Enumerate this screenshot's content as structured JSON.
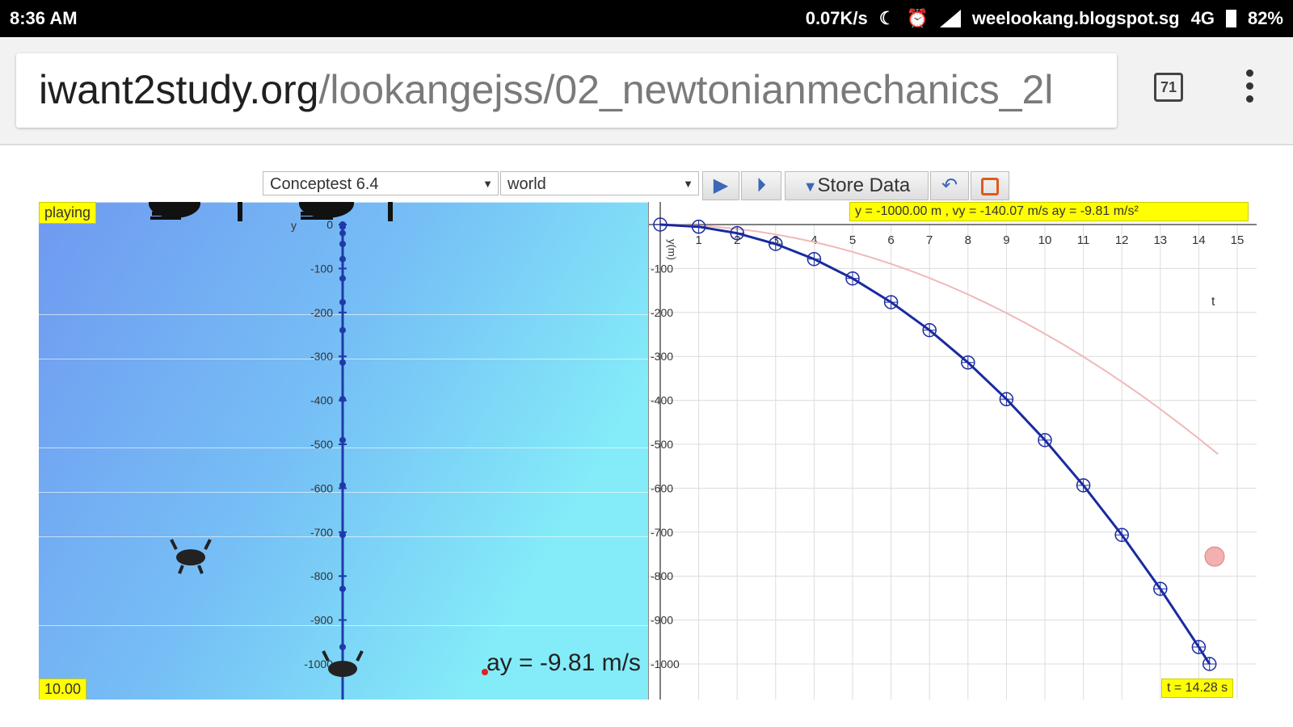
{
  "status_bar": {
    "time": "8:36 AM",
    "speed": "0.07K/s",
    "site": "weelookang.blogspot.sg",
    "network": "4G",
    "battery": "82%"
  },
  "browser": {
    "url_host": "iwant2study.org",
    "url_path": "/lookangejss/02_newtonianmechanics_2l",
    "tab_count": "71"
  },
  "controls": {
    "concept_select": "Conceptest 6.4",
    "frame_select": "world",
    "store_data_label": "Store Data"
  },
  "sim": {
    "status_tag": "playing",
    "time_tag": "10.00",
    "axis_title": "y",
    "y_ticks": [
      "0",
      "-100",
      "-200",
      "-300",
      "-400",
      "-500",
      "-600",
      "-700",
      "-800",
      "-900",
      "-1000"
    ],
    "accel_label": "ay = -9.81 m/s"
  },
  "graph": {
    "readout": "y = -1000.00 m , vy = -140.07 m/s ay = -9.81 m/s²",
    "t_readout": "t = 14.28 s",
    "x_axis_label": "t",
    "y_axis_label": "y(m)",
    "x_ticks": [
      "1",
      "2",
      "3",
      "4",
      "5",
      "6",
      "7",
      "8",
      "9",
      "10",
      "11",
      "12",
      "13",
      "14",
      "15"
    ],
    "y_ticks": [
      "-100",
      "-200",
      "-300",
      "-400",
      "-500",
      "-600",
      "-700",
      "-800",
      "-900",
      "-1000"
    ]
  },
  "chart_data": {
    "type": "line",
    "x": [
      0,
      1,
      2,
      3,
      4,
      5,
      6,
      7,
      8,
      9,
      10,
      11,
      12,
      13,
      14,
      14.28
    ],
    "series": [
      {
        "values": [
          0,
          -4.9,
          -19.6,
          -44.1,
          -78.5,
          -122.6,
          -176.6,
          -240.3,
          -313.9,
          -397.3,
          -490.5,
          -593.5,
          -706.3,
          -829.0,
          -961.4,
          -1000
        ]
      }
    ],
    "xlim": [
      0,
      15
    ],
    "ylim": [
      -1000,
      0
    ],
    "grid": true
  }
}
